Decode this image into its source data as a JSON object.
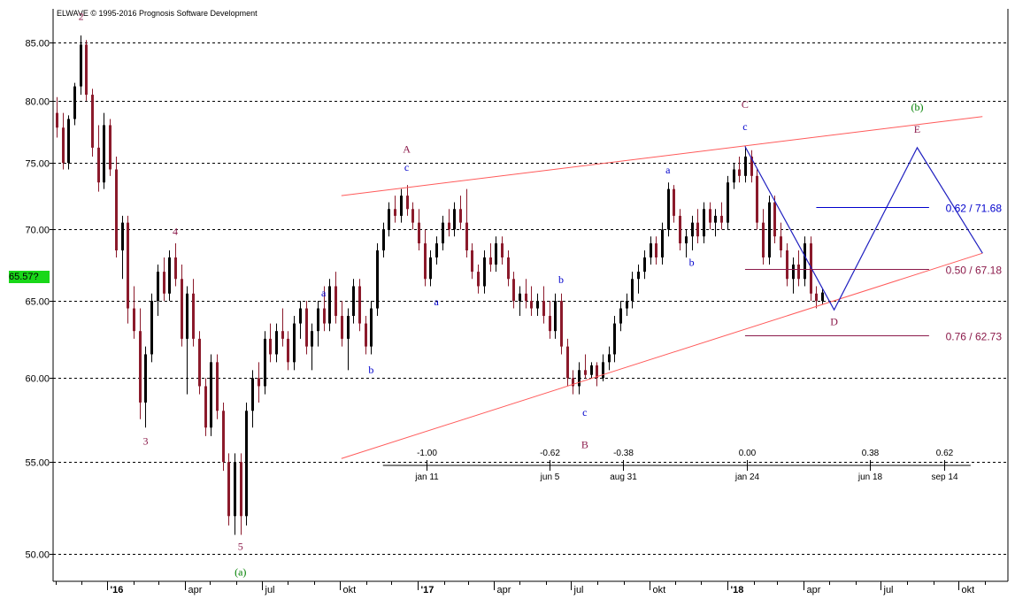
{
  "header": {
    "copyright": "ELWAVE © 1995-2016 Prognosis Software Development"
  },
  "current_price_label": "65.57?",
  "colors": {
    "up": "#000000",
    "down": "#8b1a2b",
    "wave_primary": "#8b1a4a",
    "wave_minor": "#0000cc",
    "wave_green": "#008000",
    "trend": "#ff5a5a",
    "projection": "#2020c0",
    "fib_blue": "#0000cc",
    "fib_red": "#8b1a4a",
    "badge": "#19d719"
  },
  "chart_data": {
    "type": "candlestick",
    "title": "",
    "xlabel": "",
    "ylabel": "",
    "y_scale": "log",
    "ylim": [
      48.6,
      88.0
    ],
    "y_ticks": [
      "85.00",
      "80.00",
      "75.00",
      "70.00",
      "65.00",
      "60.00",
      "55.00",
      "50.00"
    ],
    "x_tick_labels": [
      "'16",
      "apr",
      "jul",
      "okt",
      "'17",
      "apr",
      "jul",
      "okt",
      "'18",
      "apr",
      "jul",
      "okt"
    ],
    "grid": "horizontal dashed",
    "candles": [
      [
        "2015-11-02",
        79.0,
        80.3,
        77.0,
        77.8
      ],
      [
        "2015-11-09",
        77.8,
        79.0,
        74.5,
        75.0
      ],
      [
        "2015-11-16",
        75.0,
        78.8,
        74.5,
        78.5
      ],
      [
        "2015-11-23",
        78.5,
        81.5,
        78.0,
        81.2
      ],
      [
        "2015-11-30",
        81.2,
        85.6,
        80.5,
        84.8
      ],
      [
        "2015-12-07",
        84.8,
        85.2,
        80.0,
        80.5
      ],
      [
        "2015-12-14",
        80.5,
        81.0,
        75.5,
        76.2
      ],
      [
        "2015-12-21",
        76.2,
        78.0,
        72.8,
        73.5
      ],
      [
        "2015-12-28",
        73.5,
        79.0,
        73.0,
        78.0
      ],
      [
        "2016-01-04",
        78.0,
        78.5,
        74.0,
        74.5
      ],
      [
        "2016-01-11",
        74.5,
        75.5,
        68.0,
        68.5
      ],
      [
        "2016-01-18",
        68.5,
        71.0,
        66.5,
        70.5
      ],
      [
        "2016-01-25",
        70.5,
        71.0,
        63.5,
        64.5
      ],
      [
        "2016-02-01",
        64.5,
        66.0,
        62.5,
        63.0
      ],
      [
        "2016-02-08",
        63.0,
        64.5,
        57.5,
        58.5
      ],
      [
        "2016-02-15",
        58.5,
        62.0,
        57.0,
        61.5
      ],
      [
        "2016-02-22",
        61.5,
        65.5,
        61.0,
        65.0
      ],
      [
        "2016-02-29",
        65.0,
        67.5,
        64.0,
        67.0
      ],
      [
        "2016-03-07",
        67.0,
        68.0,
        65.0,
        65.5
      ],
      [
        "2016-03-14",
        65.5,
        68.5,
        65.0,
        68.0
      ],
      [
        "2016-03-21",
        68.0,
        69.0,
        66.0,
        66.5
      ],
      [
        "2016-03-28",
        66.5,
        67.5,
        62.0,
        62.5
      ],
      [
        "2016-04-04",
        62.5,
        66.0,
        59.0,
        65.5
      ],
      [
        "2016-04-11",
        65.5,
        66.5,
        62.0,
        62.5
      ],
      [
        "2016-04-18",
        62.5,
        63.0,
        59.0,
        59.5
      ],
      [
        "2016-04-25",
        59.5,
        60.0,
        56.5,
        57.0
      ],
      [
        "2016-05-02",
        57.0,
        61.5,
        56.5,
        61.0
      ],
      [
        "2016-05-09",
        61.0,
        61.5,
        57.5,
        58.0
      ],
      [
        "2016-05-16",
        58.0,
        58.5,
        54.5,
        55.0
      ],
      [
        "2016-05-23",
        55.0,
        55.5,
        51.5,
        52.0
      ],
      [
        "2016-05-30",
        52.0,
        55.5,
        51.0,
        55.0
      ],
      [
        "2016-06-06",
        55.0,
        55.5,
        51.0,
        52.0
      ],
      [
        "2016-06-13",
        52.0,
        58.5,
        51.5,
        58.0
      ],
      [
        "2016-06-20",
        58.0,
        60.5,
        57.0,
        60.0
      ],
      [
        "2016-06-27",
        60.0,
        61.0,
        58.5,
        59.5
      ],
      [
        "2016-07-04",
        59.5,
        63.0,
        59.0,
        62.5
      ],
      [
        "2016-07-11",
        62.5,
        63.5,
        61.0,
        61.5
      ],
      [
        "2016-07-18",
        61.5,
        63.5,
        61.0,
        63.0
      ],
      [
        "2016-07-25",
        63.0,
        64.5,
        62.0,
        62.5
      ],
      [
        "2016-08-01",
        62.5,
        63.0,
        60.5,
        61.0
      ],
      [
        "2016-08-08",
        61.0,
        64.0,
        60.5,
        63.5
      ],
      [
        "2016-08-15",
        63.5,
        65.0,
        62.5,
        64.5
      ],
      [
        "2016-08-22",
        64.5,
        65.0,
        61.5,
        62.0
      ],
      [
        "2016-08-29",
        62.0,
        63.5,
        60.5,
        63.0
      ],
      [
        "2016-09-05",
        63.0,
        65.0,
        62.0,
        64.5
      ],
      [
        "2016-09-12",
        64.5,
        66.0,
        63.0,
        63.5
      ],
      [
        "2016-09-19",
        63.5,
        66.5,
        63.0,
        66.0
      ],
      [
        "2016-09-26",
        66.0,
        67.0,
        63.5,
        64.0
      ],
      [
        "2016-10-03",
        64.0,
        65.0,
        62.0,
        62.5
      ],
      [
        "2016-10-10",
        62.5,
        64.5,
        60.5,
        64.0
      ],
      [
        "2016-10-17",
        64.0,
        66.5,
        63.5,
        66.0
      ],
      [
        "2016-10-24",
        66.0,
        66.5,
        63.0,
        63.5
      ],
      [
        "2016-10-31",
        63.5,
        64.0,
        61.5,
        62.0
      ],
      [
        "2016-11-07",
        62.0,
        65.0,
        61.5,
        64.5
      ],
      [
        "2016-11-14",
        64.5,
        69.0,
        64.0,
        68.5
      ],
      [
        "2016-11-21",
        68.5,
        70.5,
        68.0,
        70.0
      ],
      [
        "2016-11-28",
        70.0,
        72.0,
        69.5,
        71.5
      ],
      [
        "2016-12-05",
        71.5,
        72.5,
        70.5,
        71.0
      ],
      [
        "2016-12-12",
        71.0,
        73.0,
        70.5,
        72.5
      ],
      [
        "2016-12-19",
        72.5,
        73.3,
        71.0,
        71.5
      ],
      [
        "2016-12-26",
        71.5,
        72.0,
        70.0,
        70.5
      ],
      [
        "2017-01-02",
        70.5,
        71.5,
        68.5,
        69.0
      ],
      [
        "2017-01-09",
        69.0,
        70.0,
        66.0,
        66.5
      ],
      [
        "2017-01-16",
        66.5,
        68.5,
        66.0,
        68.0
      ],
      [
        "2017-01-23",
        68.0,
        69.5,
        67.5,
        69.0
      ],
      [
        "2017-01-30",
        69.0,
        71.0,
        68.5,
        70.5
      ],
      [
        "2017-02-06",
        70.5,
        71.5,
        69.5,
        70.0
      ],
      [
        "2017-02-13",
        70.0,
        72.0,
        69.5,
        71.5
      ],
      [
        "2017-02-20",
        71.5,
        72.5,
        70.0,
        70.5
      ],
      [
        "2017-02-27",
        70.5,
        73.0,
        68.0,
        68.5
      ],
      [
        "2017-03-06",
        68.5,
        69.0,
        66.5,
        67.0
      ],
      [
        "2017-03-13",
        67.0,
        67.5,
        65.5,
        66.0
      ],
      [
        "2017-03-20",
        66.0,
        68.5,
        65.5,
        68.0
      ],
      [
        "2017-03-27",
        68.0,
        69.0,
        67.0,
        67.5
      ],
      [
        "2017-04-03",
        67.5,
        69.5,
        67.0,
        69.0
      ],
      [
        "2017-04-10",
        69.0,
        69.5,
        67.5,
        68.0
      ],
      [
        "2017-04-17",
        68.0,
        68.5,
        66.0,
        66.5
      ],
      [
        "2017-04-24",
        66.5,
        67.0,
        64.5,
        65.0
      ],
      [
        "2017-05-01",
        65.0,
        66.0,
        64.0,
        65.5
      ],
      [
        "2017-05-08",
        65.5,
        66.5,
        64.5,
        65.0
      ],
      [
        "2017-05-15",
        65.0,
        66.0,
        64.0,
        64.5
      ],
      [
        "2017-05-22",
        64.5,
        65.5,
        64.0,
        65.0
      ],
      [
        "2017-05-29",
        65.0,
        66.0,
        63.5,
        64.0
      ],
      [
        "2017-06-05",
        64.0,
        65.0,
        62.5,
        63.0
      ],
      [
        "2017-06-12",
        63.0,
        65.5,
        62.5,
        65.0
      ],
      [
        "2017-06-19",
        65.0,
        65.5,
        61.5,
        62.0
      ],
      [
        "2017-06-26",
        62.0,
        62.5,
        59.5,
        60.0
      ],
      [
        "2017-07-03",
        60.0,
        60.5,
        59.0,
        59.5
      ],
      [
        "2017-07-10",
        59.5,
        61.0,
        59.0,
        60.5
      ],
      [
        "2017-07-17",
        60.5,
        61.5,
        60.0,
        60.2
      ],
      [
        "2017-07-24",
        60.2,
        61.0,
        60.0,
        60.8
      ],
      [
        "2017-07-31",
        60.8,
        61.0,
        59.5,
        60.0
      ],
      [
        "2017-08-07",
        60.0,
        61.5,
        59.8,
        61.0
      ],
      [
        "2017-08-14",
        61.0,
        62.0,
        60.5,
        61.5
      ],
      [
        "2017-08-21",
        61.5,
        64.0,
        61.0,
        63.5
      ],
      [
        "2017-08-28",
        63.5,
        65.0,
        63.0,
        64.5
      ],
      [
        "2017-09-04",
        64.5,
        65.5,
        64.0,
        65.0
      ],
      [
        "2017-09-11",
        65.0,
        67.0,
        64.5,
        66.5
      ],
      [
        "2017-09-18",
        66.5,
        67.5,
        65.5,
        67.0
      ],
      [
        "2017-09-25",
        67.0,
        68.5,
        66.5,
        68.0
      ],
      [
        "2017-10-02",
        68.0,
        69.5,
        67.5,
        69.0
      ],
      [
        "2017-10-09",
        69.0,
        69.5,
        67.5,
        68.0
      ],
      [
        "2017-10-16",
        68.0,
        70.5,
        67.5,
        70.0
      ],
      [
        "2017-10-23",
        70.0,
        73.5,
        69.5,
        73.0
      ],
      [
        "2017-10-30",
        73.0,
        73.3,
        70.5,
        71.0
      ],
      [
        "2017-11-06",
        71.0,
        71.5,
        68.5,
        69.0
      ],
      [
        "2017-11-13",
        69.0,
        70.0,
        68.0,
        69.5
      ],
      [
        "2017-11-20",
        69.5,
        71.0,
        68.5,
        70.5
      ],
      [
        "2017-11-27",
        70.5,
        71.5,
        69.0,
        69.5
      ],
      [
        "2017-12-04",
        69.5,
        72.0,
        69.0,
        71.5
      ],
      [
        "2017-12-11",
        71.5,
        72.0,
        70.0,
        70.5
      ],
      [
        "2017-12-18",
        70.5,
        71.5,
        69.5,
        71.0
      ],
      [
        "2017-12-25",
        71.0,
        72.0,
        70.0,
        70.5
      ],
      [
        "2018-01-01",
        70.5,
        74.0,
        70.0,
        73.5
      ],
      [
        "2018-01-08",
        73.5,
        75.0,
        73.0,
        74.5
      ],
      [
        "2018-01-15",
        74.5,
        75.5,
        73.5,
        74.0
      ],
      [
        "2018-01-22",
        74.0,
        76.3,
        73.5,
        75.5
      ],
      [
        "2018-01-29",
        75.5,
        76.0,
        73.5,
        74.0
      ],
      [
        "2018-02-05",
        74.0,
        74.5,
        70.0,
        70.5
      ],
      [
        "2018-02-12",
        70.5,
        71.5,
        67.5,
        68.0
      ],
      [
        "2018-02-19",
        68.0,
        72.5,
        67.5,
        72.0
      ],
      [
        "2018-02-26",
        72.0,
        72.5,
        69.0,
        69.5
      ],
      [
        "2018-03-05",
        69.5,
        70.5,
        68.0,
        68.5
      ],
      [
        "2018-03-12",
        68.5,
        69.0,
        66.0,
        66.5
      ],
      [
        "2018-03-19",
        66.5,
        68.0,
        65.5,
        67.5
      ],
      [
        "2018-03-26",
        67.5,
        68.5,
        66.0,
        66.5
      ],
      [
        "2018-04-02",
        66.5,
        69.5,
        66.0,
        69.0
      ],
      [
        "2018-04-09",
        69.0,
        69.5,
        65.0,
        65.5
      ],
      [
        "2018-04-16",
        65.5,
        66.0,
        64.5,
        65.0
      ],
      [
        "2018-04-23",
        65.0,
        65.8,
        64.8,
        65.57
      ]
    ],
    "trendlines": [
      {
        "points": [
          [
            "2016-10-03",
            72.5
          ],
          [
            "2018-10-29",
            78.7
          ]
        ]
      },
      {
        "points": [
          [
            "2016-10-03",
            55.2
          ],
          [
            "2018-10-29",
            68.3
          ]
        ]
      }
    ],
    "projection": {
      "points": [
        [
          "2018-01-22",
          76.3
        ],
        [
          "2018-05-07",
          64.4
        ],
        [
          "2018-08-13",
          76.2
        ],
        [
          "2018-10-29",
          68.3
        ]
      ]
    },
    "fib_levels": [
      {
        "label": "0.62 / 71.68",
        "value": 71.68,
        "color": "blue",
        "x_start": "2018-04-16",
        "x_end": "2018-08-27"
      },
      {
        "label": "0.50 / 67.18",
        "value": 67.18,
        "color": "red",
        "x_start": "2018-01-22",
        "x_end": "2018-08-27"
      },
      {
        "label": "0.76 / 62.73",
        "value": 62.73,
        "color": "red",
        "x_start": "2018-01-22",
        "x_end": "2018-08-27"
      }
    ],
    "wave_labels": [
      {
        "text": "2",
        "date": "2015-12-01",
        "price": 87.0,
        "color": "primary"
      },
      {
        "text": "3",
        "date": "2016-02-15",
        "price": 56.0,
        "color": "primary"
      },
      {
        "text": "4",
        "date": "2016-03-21",
        "price": 69.6,
        "color": "primary"
      },
      {
        "text": "5",
        "date": "2016-06-06",
        "price": 50.2,
        "color": "primary"
      },
      {
        "text": "(a)",
        "date": "2016-06-06",
        "price": 48.9,
        "color": "green"
      },
      {
        "text": "a",
        "date": "2016-09-12",
        "price": 65.3,
        "color": "minor"
      },
      {
        "text": "b",
        "date": "2016-11-07",
        "price": 60.3,
        "color": "minor"
      },
      {
        "text": "A",
        "date": "2016-12-19",
        "price": 75.8,
        "color": "primary"
      },
      {
        "text": "c",
        "date": "2016-12-19",
        "price": 74.4,
        "color": "minor"
      },
      {
        "text": "a",
        "date": "2017-01-23",
        "price": 64.7,
        "color": "minor"
      },
      {
        "text": "b",
        "date": "2017-06-19",
        "price": 66.2,
        "color": "minor"
      },
      {
        "text": "c",
        "date": "2017-07-17",
        "price": 57.7,
        "color": "minor"
      },
      {
        "text": "B",
        "date": "2017-07-17",
        "price": 55.8,
        "color": "primary"
      },
      {
        "text": "a",
        "date": "2017-10-23",
        "price": 74.2,
        "color": "minor"
      },
      {
        "text": "b",
        "date": "2017-11-20",
        "price": 67.4,
        "color": "minor"
      },
      {
        "text": "C",
        "date": "2018-01-22",
        "price": 79.4,
        "color": "primary"
      },
      {
        "text": "c",
        "date": "2018-01-22",
        "price": 77.6,
        "color": "minor"
      },
      {
        "text": "D",
        "date": "2018-05-07",
        "price": 63.4,
        "color": "primary"
      },
      {
        "text": "E",
        "date": "2018-08-13",
        "price": 77.4,
        "color": "primary"
      },
      {
        "text": "(b)",
        "date": "2018-08-13",
        "price": 79.2,
        "color": "green"
      }
    ],
    "time_ratio_scale": {
      "values": [
        "-1.00",
        "-0.62",
        "-0.38",
        "0.00",
        "0.38",
        "0.62"
      ],
      "dates": [
        "jan 11",
        "jun 5",
        "aug 31",
        "jan 24",
        "jun 18",
        "sep 14"
      ],
      "tick_dates": [
        "2017-01-11",
        "2017-06-05",
        "2017-08-31",
        "2018-01-24",
        "2018-06-18",
        "2018-09-14"
      ]
    }
  }
}
